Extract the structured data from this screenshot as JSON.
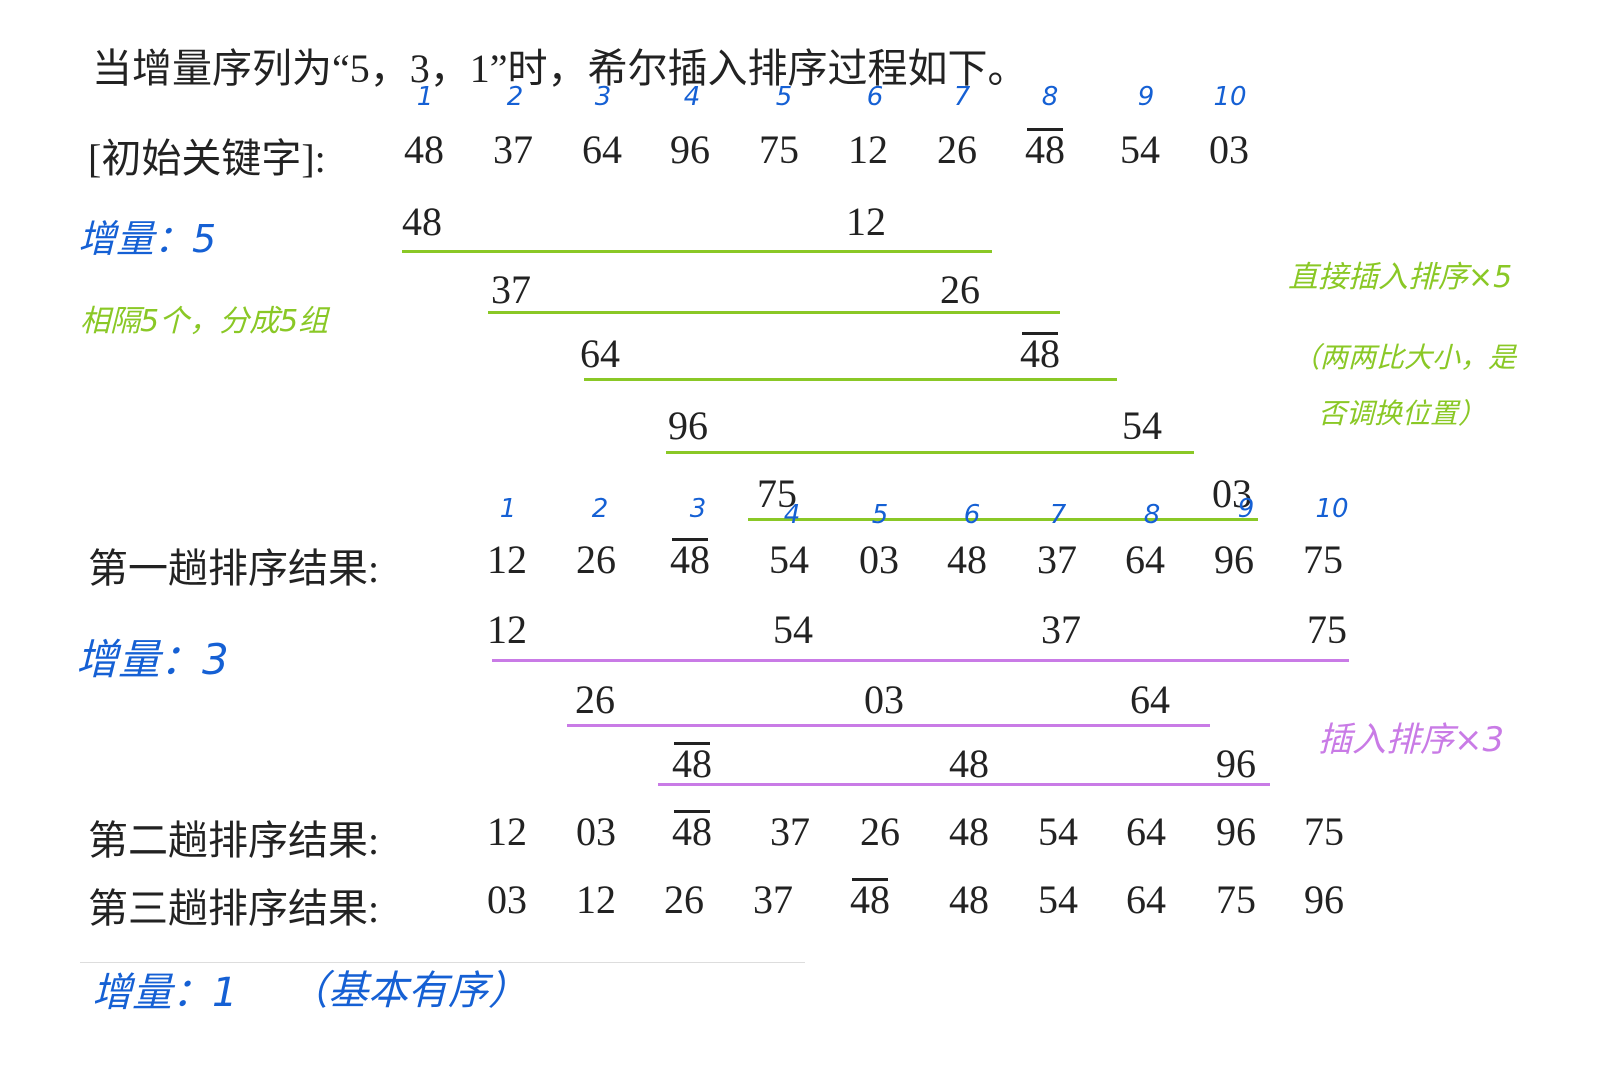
{
  "title": "当增量序列为“5，3，1”时，希尔插入排序过程如下。",
  "top_indices": [
    "1",
    "2",
    "3",
    "4",
    "5",
    "6",
    "7",
    "8",
    "9",
    "10"
  ],
  "initial": {
    "label": "[初始关键字]:",
    "keys": [
      "48",
      "37",
      "64",
      "96",
      "75",
      "12",
      "26",
      "48",
      "54",
      "03"
    ]
  },
  "pass1": {
    "annotation_increment": "增量：5",
    "annotation_groups": "相隔5个，分成5组",
    "annotation_method": "直接插入排序×5",
    "annotation_compare_1": "（两两比大小，是",
    "annotation_compare_2": "否调换位置）",
    "groups": [
      [
        "48",
        "12"
      ],
      [
        "37",
        "26"
      ],
      [
        "64",
        "48"
      ],
      [
        "96",
        "54"
      ],
      [
        "75",
        "03"
      ]
    ],
    "result_label": "第一趟排序结果:",
    "result": [
      "12",
      "26",
      "48",
      "54",
      "03",
      "48",
      "37",
      "64",
      "96",
      "75"
    ],
    "result_indices": [
      "1",
      "2",
      "3",
      "4",
      "5",
      "6",
      "7",
      "8",
      "9",
      "10"
    ]
  },
  "pass2": {
    "annotation_increment": "增量：3",
    "annotation_method": "插入排序×3",
    "groups": [
      [
        "12",
        "54",
        "37",
        "75"
      ],
      [
        "26",
        "03",
        "64"
      ],
      [
        "48",
        "48",
        "96"
      ]
    ],
    "result_label": "第二趟排序结果:",
    "result": [
      "12",
      "03",
      "48",
      "37",
      "26",
      "48",
      "54",
      "64",
      "96",
      "75"
    ]
  },
  "pass3": {
    "result_label": "第三趟排序结果:",
    "result": [
      "03",
      "12",
      "26",
      "37",
      "48",
      "48",
      "54",
      "64",
      "75",
      "96"
    ],
    "annotation_increment": "增量：1",
    "annotation_note": "（基本有序）"
  },
  "colors": {
    "handwriting_blue": "#1560d4",
    "handwriting_green": "#8ac826",
    "handwriting_purple": "#c97be6",
    "text": "#222222"
  }
}
